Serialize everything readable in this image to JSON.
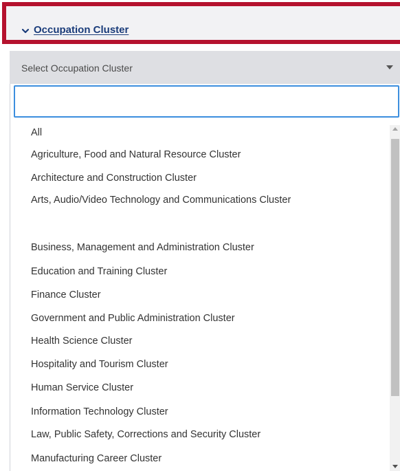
{
  "header": {
    "title": "Occupation Cluster",
    "chevron_icon": "chevron-down-icon",
    "border_color": "#b5122e",
    "link_color": "#1a3c7a"
  },
  "select": {
    "placeholder": "Select Occupation Cluster",
    "arrow_icon": "caret-down-icon"
  },
  "search": {
    "value": "",
    "focus_color": "#3b8ede"
  },
  "options": [
    "All",
    "Agriculture, Food and Natural Resource Cluster",
    "Architecture and Construction Cluster",
    "Arts, Audio/Video Technology and Communications Cluster",
    "Business, Management and Administration Cluster",
    "Education and Training Cluster",
    "Finance Cluster",
    "Government and Public Administration Cluster",
    "Health Science Cluster",
    "Hospitality and Tourism Cluster",
    "Human Service Cluster",
    "Information Technology Cluster",
    "Law, Public Safety, Corrections and Security Cluster",
    "Manufacturing Career Cluster"
  ]
}
